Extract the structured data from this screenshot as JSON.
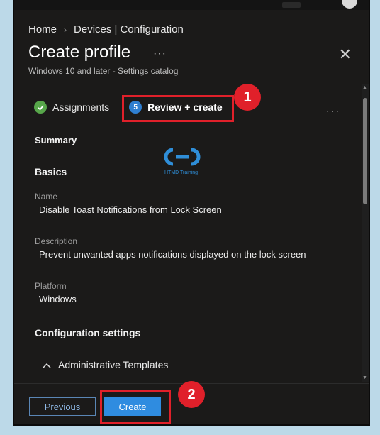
{
  "breadcrumb": {
    "home": "Home",
    "section": "Devices | Configuration"
  },
  "header": {
    "title": "Create profile",
    "more": "···",
    "subtitle": "Windows 10 and later - Settings catalog"
  },
  "tabs": [
    {
      "label": "Assignments",
      "state": "completed"
    },
    {
      "label": "Review + create",
      "state": "current",
      "icon_text": "5"
    }
  ],
  "tabs_more": "···",
  "watermark": {
    "text": "HTMD Training"
  },
  "summary": {
    "heading": "Summary",
    "basics_heading": "Basics",
    "fields": [
      {
        "label": "Name",
        "value": "Disable Toast Notifications from Lock Screen"
      },
      {
        "label": "Description",
        "value": "Prevent unwanted apps notifications displayed on the lock screen"
      },
      {
        "label": "Platform",
        "value": "Windows"
      }
    ],
    "config_heading": "Configuration settings",
    "admin_templates": "Administrative Templates"
  },
  "footer": {
    "previous": "Previous",
    "create": "Create"
  },
  "annotations": {
    "badge1": "1",
    "badge2": "2"
  },
  "colors": {
    "highlight": "#e0202a",
    "accent": "#2f8ce0",
    "success": "#57a64a",
    "background": "#1b1a19"
  }
}
